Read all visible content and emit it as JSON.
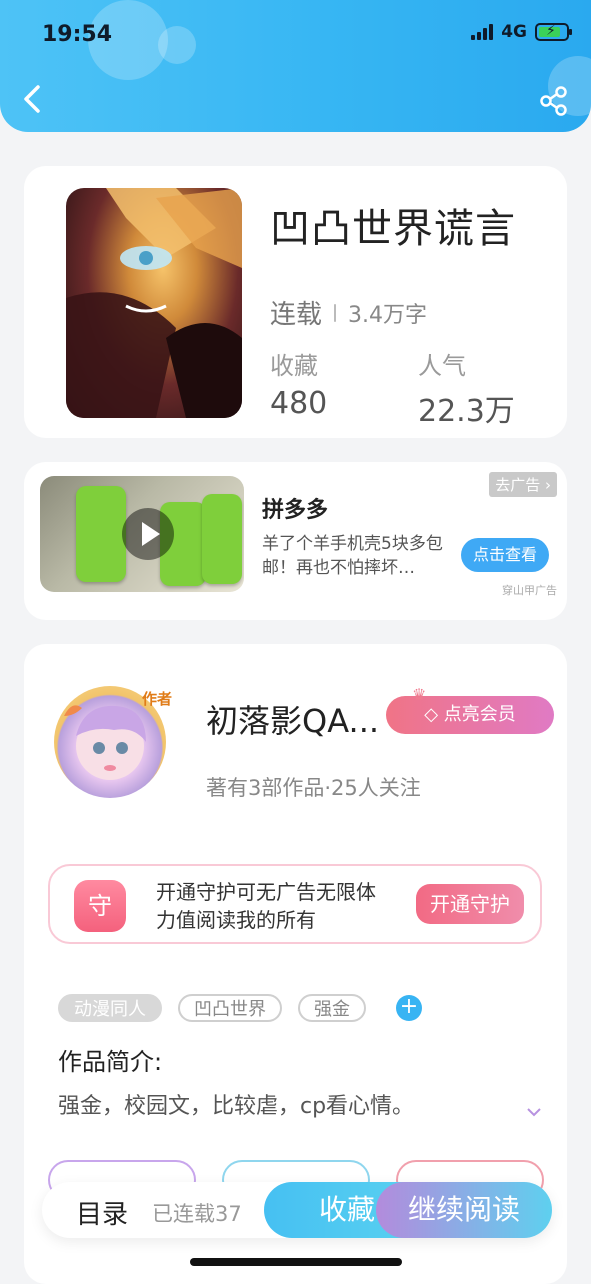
{
  "status_bar": {
    "time": "19:54",
    "network": "4G"
  },
  "book": {
    "title": "凹凸世界谎言",
    "status": "连载",
    "word_count": "3.4万字",
    "favorites_label": "收藏",
    "favorites_value": "480",
    "popularity_label": "人气",
    "popularity_value": "22.3万"
  },
  "ad": {
    "brand": "拼多多",
    "description": "羊了个羊手机壳5块多包邮！再也不怕摔坏…",
    "cta": "点击查看",
    "close_label": "去广告",
    "source": "穿山甲广告"
  },
  "author": {
    "badge": "作者",
    "name": "初落影QA...",
    "vip_button": "点亮会员",
    "summary": "著有3部作品·25人关注"
  },
  "guard": {
    "icon_text": "守",
    "text": "开通守护可无广告无限体力值阅读我的所有",
    "button": "开通守护"
  },
  "tags": [
    "动漫同人",
    "凹凸世界",
    "强金"
  ],
  "intro": {
    "title": "作品简介:",
    "text": "强金，校园文，比较虐，cp看心情。"
  },
  "bottom_bar": {
    "toc": "目录",
    "chapters": "已连载37",
    "collect": "收藏",
    "read": "继续阅读"
  },
  "colors": {
    "header": "#37b6f3",
    "accent_blue": "#3fa9f5",
    "vip_pink": "#f07486",
    "guard_pink": "#f26a84"
  }
}
